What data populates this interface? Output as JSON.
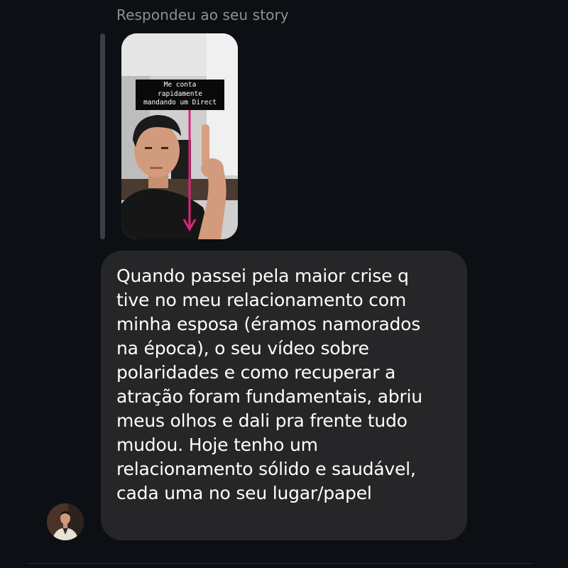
{
  "reply_context": {
    "label": "Respondeu ao seu story"
  },
  "story": {
    "caption_lines": [
      "Me conta",
      "rapidamente",
      "mandando um Direct"
    ],
    "arrow_color": "#e0237a"
  },
  "message": {
    "text": "Quando passei pela maior crise q\ntive no meu relacionamento com\nminha esposa (éramos namorados\nna época), o seu vídeo sobre\npolaridades e como recuperar a\natração foram fundamentais, abriu\nmeus olhos e dali pra frente tudo\nmudou. Hoje tenho um\nrelacionamento sólido e saudável,\ncada uma no seu lugar/papel"
  },
  "sender": {
    "avatar_icon": "user-avatar-photo"
  },
  "colors": {
    "background": "#0c1014",
    "bubble": "#262629",
    "secondary_text": "#8e8e93",
    "text": "#ffffff"
  }
}
